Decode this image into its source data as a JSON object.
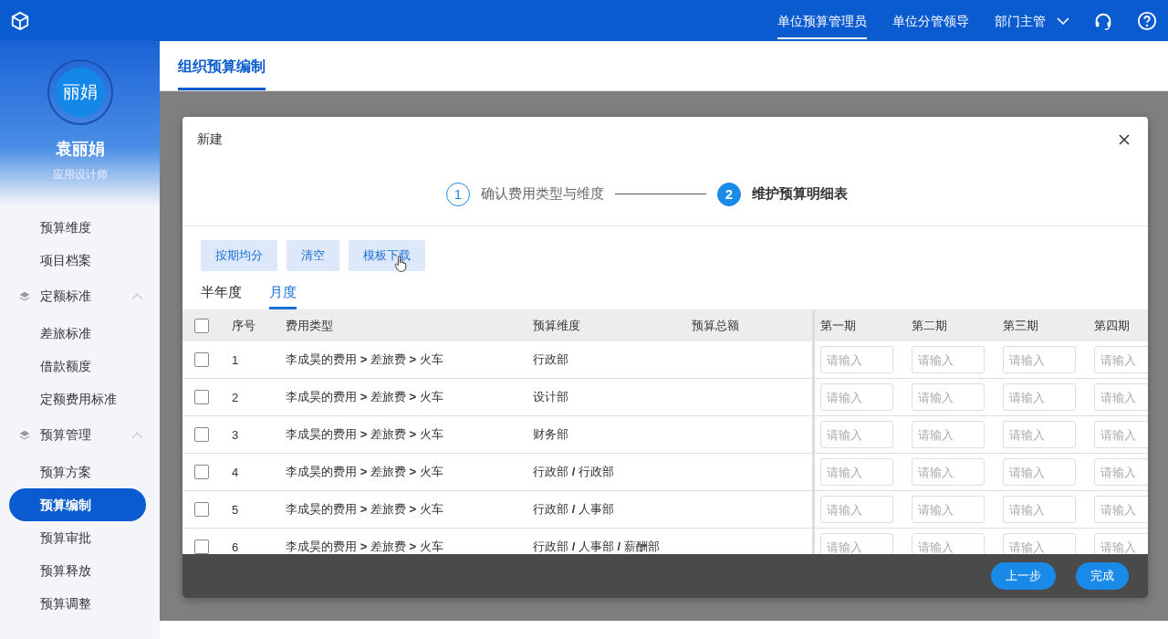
{
  "header": {
    "nav": [
      {
        "label": "单位预算管理员",
        "selected": true,
        "kind": "link"
      },
      {
        "label": "单位分管领导",
        "selected": false,
        "kind": "link"
      },
      {
        "label": "部门主管",
        "selected": false,
        "kind": "dropdown"
      }
    ]
  },
  "sidebar": {
    "avatar_text": "丽娟",
    "name": "袁丽娟",
    "role": "应用设计师",
    "items": [
      {
        "kind": "item",
        "label": "预算维度",
        "selected": false
      },
      {
        "kind": "item",
        "label": "项目档案",
        "selected": false
      },
      {
        "kind": "group",
        "label": "定额标准",
        "expanded": true,
        "children": [
          {
            "label": "差旅标准",
            "selected": false
          },
          {
            "label": "借款额度",
            "selected": false
          },
          {
            "label": "定额费用标准",
            "selected": false
          }
        ]
      },
      {
        "kind": "group",
        "label": "预算管理",
        "expanded": true,
        "children": [
          {
            "label": "预算方案",
            "selected": false
          },
          {
            "label": "预算编制",
            "selected": true
          },
          {
            "label": "预算审批",
            "selected": false
          },
          {
            "label": "预算释放",
            "selected": false
          },
          {
            "label": "预算调整",
            "selected": false
          }
        ]
      }
    ]
  },
  "page": {
    "title": "组织预算编制"
  },
  "dialog": {
    "title": "新建",
    "steps": [
      {
        "number": "1",
        "label": "确认费用类型与维度",
        "active": false
      },
      {
        "number": "2",
        "label": "维护预算明细表",
        "active": true
      }
    ],
    "actions": [
      "按期均分",
      "清空",
      "模板下载"
    ],
    "tabs": [
      {
        "label": "半年度",
        "selected": false
      },
      {
        "label": "月度",
        "selected": true
      }
    ],
    "select_all": {
      "checked": false
    },
    "columns": [
      "序号",
      "费用类型",
      "预算维度",
      "预算总额"
    ],
    "periods": [
      "第一期",
      "第二期",
      "第三期",
      "第四期"
    ],
    "rows": [
      {
        "seq": "1",
        "expense": "李成昊的费用 **>** 差旅费 **>** 火车",
        "dimension": "行政部",
        "checked": false,
        "placeholders": [
          "请输入",
          "请输入",
          "请输入",
          "请输入"
        ]
      },
      {
        "seq": "2",
        "expense": "李成昊的费用 **>** 差旅费 **>** 火车",
        "dimension": "设计部",
        "checked": false,
        "placeholders": [
          "请输入",
          "请输入",
          "请输入",
          "请输入"
        ]
      },
      {
        "seq": "3",
        "expense": "李成昊的费用 **>** 差旅费 **>** 火车",
        "dimension": "财务部",
        "checked": false,
        "placeholders": [
          "请输入",
          "请输入",
          "请输入",
          "请输入"
        ]
      },
      {
        "seq": "4",
        "expense": "李成昊的费用 **>** 差旅费 **>** 火车",
        "dimension": "行政部 **/** 行政部",
        "checked": false,
        "placeholders": [
          "请输入",
          "请输入",
          "请输入",
          "请输入"
        ]
      },
      {
        "seq": "5",
        "expense": "李成昊的费用 **>** 差旅费 **>** 火车",
        "dimension": "行政部 **/** 人事部",
        "checked": false,
        "placeholders": [
          "请输入",
          "请输入",
          "请输入",
          "请输入"
        ]
      },
      {
        "seq": "6",
        "expense": "李成昊的费用 **>** 差旅费 **>** 火车",
        "dimension": "行政部 **/** 人事部 **/** 薪酬部",
        "checked": false,
        "placeholders": [
          "请输入",
          "请输入",
          "请输入",
          "请输入"
        ]
      }
    ],
    "footer_buttons": [
      "上一步",
      "完成"
    ]
  }
}
